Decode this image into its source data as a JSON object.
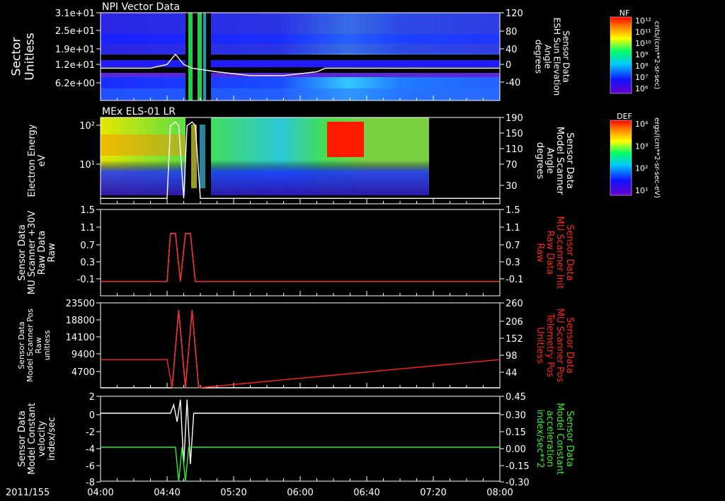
{
  "chart_data": [
    {
      "type": "heatmap",
      "title": "NPI Vector Data",
      "ylabel": [
        "Sector",
        "Unitless"
      ],
      "yticks": [
        "3.1e+01",
        "2.5e+01",
        "1.9e+01",
        "1.2e+01",
        "6.2e+00"
      ],
      "ylabel_right": [
        "Sensor Data",
        "ESH Sun Elevation",
        "Angle",
        "degrees"
      ],
      "yticks_right": [
        "120",
        "80",
        "40",
        "0",
        "-40"
      ],
      "colorbar": {
        "name": "NF",
        "label": "cnts/(cm**2-sr-sec)",
        "ticks": [
          "10¹²",
          "10¹¹",
          "10¹⁰",
          "10⁹",
          "10⁸",
          "10⁷",
          "10⁶"
        ]
      },
      "overlay": {
        "color": "#ffffff",
        "x": [
          0,
          30,
          40,
          45,
          50,
          55,
          70,
          90,
          110,
          130,
          135,
          140,
          240
        ],
        "y": [
          70,
          70,
          78,
          100,
          78,
          70,
          62,
          54,
          54,
          62,
          70,
          70,
          70
        ]
      }
    },
    {
      "type": "heatmap",
      "title": "MEx ELS-01 LR",
      "ylabel": [
        "Electron Energy",
        "eV"
      ],
      "yticks": [
        "10²",
        "10¹"
      ],
      "ylabel_right": [
        "Sensor Data",
        "Model Scanner",
        "Angle",
        "degrees"
      ],
      "yticks_right": [
        "190",
        "150",
        "110",
        "70",
        "30"
      ],
      "colorbar": {
        "name": "DEF",
        "label": "ergs/(cm**2-sr-sec-eV)",
        "ticks": [
          "10⁴",
          "10³",
          "10²",
          "10¹"
        ]
      },
      "overlay": {
        "color": "#ffffff",
        "x": [
          0,
          40,
          42,
          45,
          47,
          50,
          52,
          55,
          57,
          60,
          240
        ],
        "y": [
          12,
          12,
          172,
          180,
          172,
          12,
          172,
          180,
          172,
          12,
          12
        ]
      }
    },
    {
      "type": "line",
      "ylabel": [
        "Sensor Data",
        "MU Scanner +30V",
        "Raw Data",
        "Raw"
      ],
      "yticks": [
        "1.5",
        "1.1",
        "0.7",
        "0.3",
        "-0.1"
      ],
      "ylim": [
        -0.3,
        1.5
      ],
      "ylabel_right": [
        "Sensor Data",
        "MU Scanner Init",
        "Raw Data",
        "Raw"
      ],
      "yticks_right": [
        "1.5",
        "1.1",
        "0.7",
        "0.3",
        "-0.1"
      ],
      "series": [
        {
          "color": "#ffffff",
          "x": [
            0,
            40,
            42,
            45,
            48,
            51,
            54,
            57,
            240
          ],
          "y": [
            0,
            0,
            1,
            1,
            0,
            1,
            1,
            0,
            0
          ]
        },
        {
          "color": "#ff2020",
          "x": [
            0,
            40,
            42,
            45,
            48,
            51,
            54,
            57,
            240
          ],
          "y": [
            0,
            0,
            1,
            1,
            0,
            1,
            1,
            0,
            0
          ]
        }
      ]
    },
    {
      "type": "line",
      "ylabel": [
        "Sensor Data",
        "Model Scanner Pos",
        "Raw",
        "unitless"
      ],
      "yticks": [
        "23500",
        "18800",
        "14100",
        "9400",
        "4700"
      ],
      "ylim": [
        0,
        23500
      ],
      "ylabel_right": [
        "Sensor Data",
        "MU Scanner Pos",
        "Telemetry Pos",
        "Unitless"
      ],
      "yticks_right": [
        "260",
        "206",
        "152",
        "98",
        "44"
      ],
      "series": [
        {
          "color": "#ffffff",
          "x": [
            0,
            40,
            43,
            47,
            51,
            55,
            59,
            240
          ],
          "y": [
            0,
            0,
            0,
            21500,
            0,
            21500,
            0,
            0
          ]
        },
        {
          "color": "#ff2020",
          "x": [
            0,
            40,
            43,
            47,
            51,
            55,
            59,
            240
          ],
          "y": [
            7800,
            7800,
            0,
            21500,
            0,
            21500,
            0,
            7800
          ]
        }
      ]
    },
    {
      "type": "line",
      "ylabel": [
        "Sensor Data",
        "Model Constant",
        "velocity",
        "index/sec"
      ],
      "yticks": [
        "2",
        "0",
        "-2",
        "-4",
        "-6",
        "-8"
      ],
      "ylim": [
        -8,
        2
      ],
      "ylabel_right": [
        "Sensor Data",
        "Model Constant",
        "acceleration",
        "index/sec**2"
      ],
      "yticks_right": [
        "0.45",
        "0.30",
        "0.15",
        "0.00",
        "-0.15",
        "-0.30"
      ],
      "xlabel_start": "2011/155",
      "xticks": [
        "04:00",
        "04:40",
        "05:20",
        "06:00",
        "06:40",
        "07:20",
        "08:00"
      ],
      "series": [
        {
          "color": "#ffffff",
          "x": [
            0,
            42,
            44,
            46,
            48,
            50,
            52,
            54,
            56,
            240
          ],
          "y": [
            0,
            0,
            1,
            -1,
            1.6,
            -6,
            1.6,
            -6,
            0,
            0
          ]
        },
        {
          "color": "#33ee33",
          "x": [
            0,
            45,
            47,
            49,
            51,
            53,
            55,
            240
          ],
          "y": [
            -4,
            -4,
            -8,
            -4,
            -8,
            -4,
            -4,
            -4
          ]
        }
      ]
    }
  ]
}
